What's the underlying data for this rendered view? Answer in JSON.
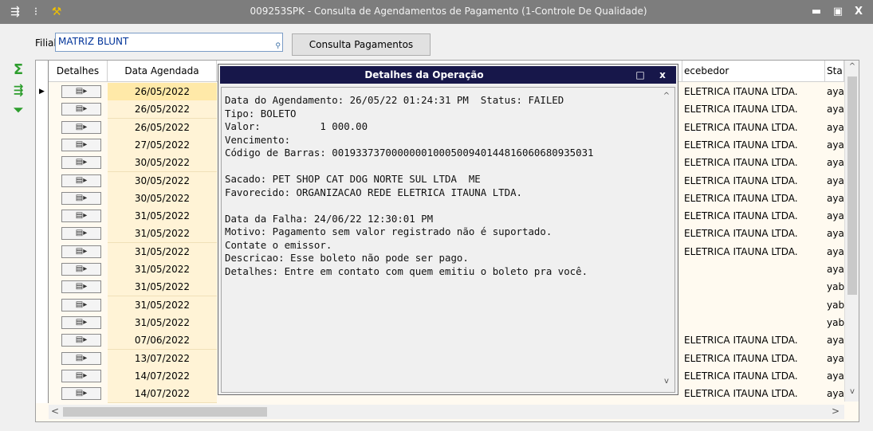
{
  "window": {
    "title": "009253SPK - Consulta de Agendamentos de Pagamento (1-Controle De Qualidade)",
    "buttons": {
      "minimize": "▬",
      "maximize": "▣",
      "close": "X"
    }
  },
  "filter": {
    "label": "Filial:",
    "value": "MATRIZ BLUNT",
    "button": "Consulta Pagamentos"
  },
  "side_icons": [
    "sigma-icon",
    "export-icon",
    "filter-down-icon"
  ],
  "grid": {
    "headers": {
      "detalhes": "Detalhes",
      "data": "Data Agendada",
      "recebedor": "ecebedor",
      "status": "Sta"
    },
    "detail_button_glyph": "▤▸",
    "rows": [
      {
        "date": "26/05/2022",
        "recebedor": "ELETRICA ITAUNA LTDA.",
        "status": "aya"
      },
      {
        "date": "26/05/2022",
        "recebedor": "ELETRICA ITAUNA LTDA.",
        "status": "aya"
      },
      {
        "date": "26/05/2022",
        "recebedor": "ELETRICA ITAUNA LTDA.",
        "status": "aya"
      },
      {
        "date": "27/05/2022",
        "recebedor": "ELETRICA ITAUNA LTDA.",
        "status": "aya"
      },
      {
        "date": "30/05/2022",
        "recebedor": "ELETRICA ITAUNA LTDA.",
        "status": "aya"
      },
      {
        "date": "30/05/2022",
        "recebedor": "ELETRICA ITAUNA LTDA.",
        "status": "aya"
      },
      {
        "date": "30/05/2022",
        "recebedor": "ELETRICA ITAUNA LTDA.",
        "status": "aya"
      },
      {
        "date": "31/05/2022",
        "recebedor": "ELETRICA ITAUNA LTDA.",
        "status": "aya"
      },
      {
        "date": "31/05/2022",
        "recebedor": "ELETRICA ITAUNA LTDA.",
        "status": "aya"
      },
      {
        "date": "31/05/2022",
        "recebedor": "ELETRICA ITAUNA LTDA.",
        "status": "aya"
      },
      {
        "date": "31/05/2022",
        "recebedor": "",
        "status": "aya"
      },
      {
        "date": "31/05/2022",
        "recebedor": "",
        "status": "yab"
      },
      {
        "date": "31/05/2022",
        "recebedor": "",
        "status": "yab"
      },
      {
        "date": "31/05/2022",
        "recebedor": "",
        "status": "yab"
      },
      {
        "date": "07/06/2022",
        "recebedor": "ELETRICA ITAUNA LTDA.",
        "status": "aya"
      },
      {
        "date": "13/07/2022",
        "recebedor": "ELETRICA ITAUNA LTDA.",
        "status": "aya"
      },
      {
        "date": "14/07/2022",
        "recebedor": "ELETRICA ITAUNA LTDA.",
        "status": "aya"
      },
      {
        "date": "14/07/2022",
        "recebedor": "ELETRICA ITAUNA LTDA.",
        "status": "aya"
      }
    ],
    "scroll": {
      "left": "<",
      "right": ">",
      "up": "^",
      "down": "v"
    }
  },
  "dialog": {
    "title": "Detalhes da Operação",
    "maximize": "□",
    "close": "x",
    "lines": [
      "Data do Agendamento: 26/05/22 01:24:31 PM  Status: FAILED",
      "Tipo: BOLETO",
      "Valor:          1 000.00",
      "Vencimento:",
      "Código de Barras: 00193373700000001000500940144816060680935031",
      "",
      "Sacado: PET SHOP CAT DOG NORTE SUL LTDA  ME",
      "Favorecido: ORGANIZACAO REDE ELETRICA ITAUNA LTDA.",
      "",
      "Data da Falha: 24/06/22 12:30:01 PM",
      "Motivo: Pagamento sem valor registrado não é suportado.",
      "Contate o emissor.",
      "Descricao: Esse boleto não pode ser pago.",
      "Detalhes: Entre em contato com quem emitiu o boleto pra você."
    ],
    "scroll": {
      "up": "^",
      "down": "v"
    }
  },
  "colors": {
    "titlebar": "#7d7d7d",
    "dialog_title": "#17174a",
    "grid_bg": "#fffaf0",
    "date_bg": "#fff3d6",
    "filial_text": "#003399"
  }
}
